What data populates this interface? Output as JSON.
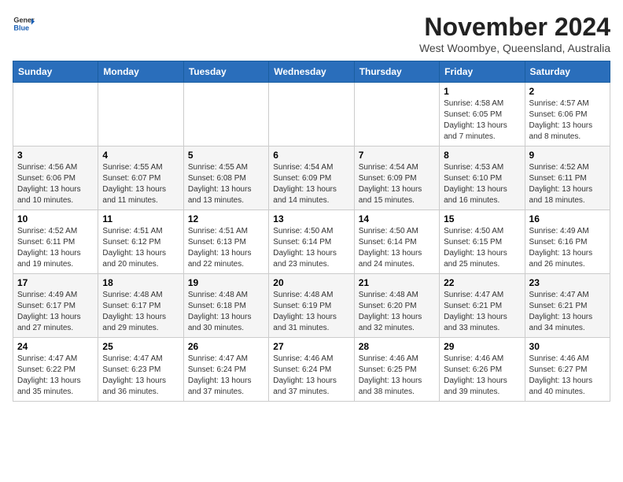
{
  "logo": {
    "general": "General",
    "blue": "Blue"
  },
  "title": "November 2024",
  "subtitle": "West Woombye, Queensland, Australia",
  "days_of_week": [
    "Sunday",
    "Monday",
    "Tuesday",
    "Wednesday",
    "Thursday",
    "Friday",
    "Saturday"
  ],
  "weeks": [
    [
      {
        "day": "",
        "detail": ""
      },
      {
        "day": "",
        "detail": ""
      },
      {
        "day": "",
        "detail": ""
      },
      {
        "day": "",
        "detail": ""
      },
      {
        "day": "",
        "detail": ""
      },
      {
        "day": "1",
        "detail": "Sunrise: 4:58 AM\nSunset: 6:05 PM\nDaylight: 13 hours\nand 7 minutes."
      },
      {
        "day": "2",
        "detail": "Sunrise: 4:57 AM\nSunset: 6:06 PM\nDaylight: 13 hours\nand 8 minutes."
      }
    ],
    [
      {
        "day": "3",
        "detail": "Sunrise: 4:56 AM\nSunset: 6:06 PM\nDaylight: 13 hours\nand 10 minutes."
      },
      {
        "day": "4",
        "detail": "Sunrise: 4:55 AM\nSunset: 6:07 PM\nDaylight: 13 hours\nand 11 minutes."
      },
      {
        "day": "5",
        "detail": "Sunrise: 4:55 AM\nSunset: 6:08 PM\nDaylight: 13 hours\nand 13 minutes."
      },
      {
        "day": "6",
        "detail": "Sunrise: 4:54 AM\nSunset: 6:09 PM\nDaylight: 13 hours\nand 14 minutes."
      },
      {
        "day": "7",
        "detail": "Sunrise: 4:54 AM\nSunset: 6:09 PM\nDaylight: 13 hours\nand 15 minutes."
      },
      {
        "day": "8",
        "detail": "Sunrise: 4:53 AM\nSunset: 6:10 PM\nDaylight: 13 hours\nand 16 minutes."
      },
      {
        "day": "9",
        "detail": "Sunrise: 4:52 AM\nSunset: 6:11 PM\nDaylight: 13 hours\nand 18 minutes."
      }
    ],
    [
      {
        "day": "10",
        "detail": "Sunrise: 4:52 AM\nSunset: 6:11 PM\nDaylight: 13 hours\nand 19 minutes."
      },
      {
        "day": "11",
        "detail": "Sunrise: 4:51 AM\nSunset: 6:12 PM\nDaylight: 13 hours\nand 20 minutes."
      },
      {
        "day": "12",
        "detail": "Sunrise: 4:51 AM\nSunset: 6:13 PM\nDaylight: 13 hours\nand 22 minutes."
      },
      {
        "day": "13",
        "detail": "Sunrise: 4:50 AM\nSunset: 6:14 PM\nDaylight: 13 hours\nand 23 minutes."
      },
      {
        "day": "14",
        "detail": "Sunrise: 4:50 AM\nSunset: 6:14 PM\nDaylight: 13 hours\nand 24 minutes."
      },
      {
        "day": "15",
        "detail": "Sunrise: 4:50 AM\nSunset: 6:15 PM\nDaylight: 13 hours\nand 25 minutes."
      },
      {
        "day": "16",
        "detail": "Sunrise: 4:49 AM\nSunset: 6:16 PM\nDaylight: 13 hours\nand 26 minutes."
      }
    ],
    [
      {
        "day": "17",
        "detail": "Sunrise: 4:49 AM\nSunset: 6:17 PM\nDaylight: 13 hours\nand 27 minutes."
      },
      {
        "day": "18",
        "detail": "Sunrise: 4:48 AM\nSunset: 6:17 PM\nDaylight: 13 hours\nand 29 minutes."
      },
      {
        "day": "19",
        "detail": "Sunrise: 4:48 AM\nSunset: 6:18 PM\nDaylight: 13 hours\nand 30 minutes."
      },
      {
        "day": "20",
        "detail": "Sunrise: 4:48 AM\nSunset: 6:19 PM\nDaylight: 13 hours\nand 31 minutes."
      },
      {
        "day": "21",
        "detail": "Sunrise: 4:48 AM\nSunset: 6:20 PM\nDaylight: 13 hours\nand 32 minutes."
      },
      {
        "day": "22",
        "detail": "Sunrise: 4:47 AM\nSunset: 6:21 PM\nDaylight: 13 hours\nand 33 minutes."
      },
      {
        "day": "23",
        "detail": "Sunrise: 4:47 AM\nSunset: 6:21 PM\nDaylight: 13 hours\nand 34 minutes."
      }
    ],
    [
      {
        "day": "24",
        "detail": "Sunrise: 4:47 AM\nSunset: 6:22 PM\nDaylight: 13 hours\nand 35 minutes."
      },
      {
        "day": "25",
        "detail": "Sunrise: 4:47 AM\nSunset: 6:23 PM\nDaylight: 13 hours\nand 36 minutes."
      },
      {
        "day": "26",
        "detail": "Sunrise: 4:47 AM\nSunset: 6:24 PM\nDaylight: 13 hours\nand 37 minutes."
      },
      {
        "day": "27",
        "detail": "Sunrise: 4:46 AM\nSunset: 6:24 PM\nDaylight: 13 hours\nand 37 minutes."
      },
      {
        "day": "28",
        "detail": "Sunrise: 4:46 AM\nSunset: 6:25 PM\nDaylight: 13 hours\nand 38 minutes."
      },
      {
        "day": "29",
        "detail": "Sunrise: 4:46 AM\nSunset: 6:26 PM\nDaylight: 13 hours\nand 39 minutes."
      },
      {
        "day": "30",
        "detail": "Sunrise: 4:46 AM\nSunset: 6:27 PM\nDaylight: 13 hours\nand 40 minutes."
      }
    ]
  ]
}
